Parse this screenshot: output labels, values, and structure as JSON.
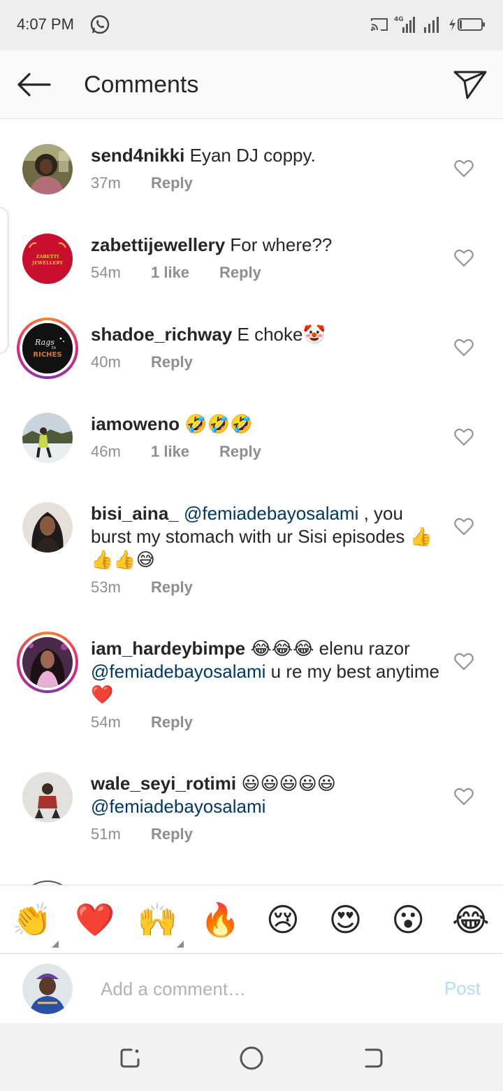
{
  "status_bar": {
    "time": "4:07 PM",
    "network_label": "4G"
  },
  "header": {
    "title": "Comments"
  },
  "comments": [
    {
      "username": "send4nikki",
      "text": " Eyan DJ coppy.",
      "time": "37m",
      "likes": "",
      "reply": "Reply"
    },
    {
      "username": "zabettijewellery",
      "text": " For where??",
      "time": "54m",
      "likes": "1 like",
      "reply": "Reply",
      "avatar_text": "ZABETTI JEWELLERY"
    },
    {
      "username": "shadoe_richway",
      "text": " E choke🤡",
      "time": "40m",
      "likes": "",
      "reply": "Reply",
      "avatar_text_1": "Rags to",
      "avatar_text_2": "RICHES"
    },
    {
      "username": "iamoweno",
      "text": " 🤣🤣🤣",
      "time": "46m",
      "likes": "1 like",
      "reply": "Reply"
    },
    {
      "username": "bisi_aina_",
      "mention": "@femiadebayosalami",
      "text": " , you burst my stomach with ur Sisi episodes 👍👍👍😅",
      "time": "53m",
      "likes": "",
      "reply": "Reply"
    },
    {
      "username": "iam_hardeybimpe",
      "text_before": " 😂😂😂 elenu razor ",
      "mention": "@femiadebayosalami",
      "text": " u re my best anytime ❤️",
      "time": "54m",
      "likes": "",
      "reply": "Reply"
    },
    {
      "username": "wale_seyi_rotimi",
      "text_before": " 😃😃😃😃😃 ",
      "mention": "@femiadebayosalami",
      "time": "51m",
      "likes": "",
      "reply": "Reply"
    }
  ],
  "emoji_bar": [
    "👏",
    "❤️",
    "🙌",
    "🔥",
    "😢",
    "😍",
    "😮",
    "😂"
  ],
  "composer": {
    "placeholder": "Add a comment…",
    "post_label": "Post"
  },
  "colors": {
    "mention": "#00376b",
    "meta": "#8e8e8e",
    "post_disabled": "#b3dbff"
  }
}
